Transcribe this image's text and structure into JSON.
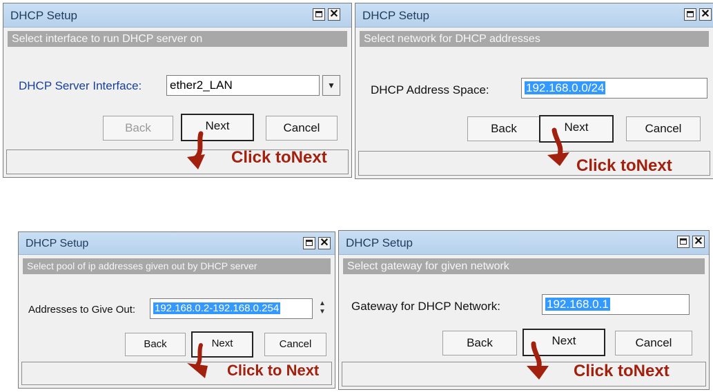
{
  "accent_colors": {
    "annotation": "#a2200e",
    "selection": "#3399ff",
    "titlebar": "#c4dbf2"
  },
  "icons": [
    "restore-icon",
    "close-icon",
    "dropdown-arrow-icon",
    "spinner-icon",
    "pointer-arrow-icon"
  ],
  "dialogs": [
    {
      "title": "DHCP Setup",
      "subtitle": "Select interface to run DHCP server on",
      "field_label": "DHCP Server Interface:",
      "field_value": "ether2_LAN",
      "buttons": {
        "back": "Back",
        "next": "Next",
        "cancel": "Cancel"
      },
      "annotation": "Click toNext"
    },
    {
      "title": "DHCP Setup",
      "subtitle": "Select network for DHCP addresses",
      "field_label": "DHCP Address Space:",
      "field_value": "192.168.0.0/24",
      "buttons": {
        "back": "Back",
        "next": "Next",
        "cancel": "Cancel"
      },
      "annotation": "Click toNext"
    },
    {
      "title": "DHCP Setup",
      "subtitle": "Select pool of ip addresses given out by DHCP server",
      "field_label": "Addresses to Give Out:",
      "field_value": "192.168.0.2-192.168.0.254",
      "buttons": {
        "back": "Back",
        "next": "Next",
        "cancel": "Cancel"
      },
      "annotation": "Click to Next"
    },
    {
      "title": "DHCP Setup",
      "subtitle": "Select gateway for given network",
      "field_label": "Gateway for DHCP Network:",
      "field_value": "192.168.0.1",
      "buttons": {
        "back": "Back",
        "next": "Next",
        "cancel": "Cancel"
      },
      "annotation": "Click toNext"
    }
  ]
}
